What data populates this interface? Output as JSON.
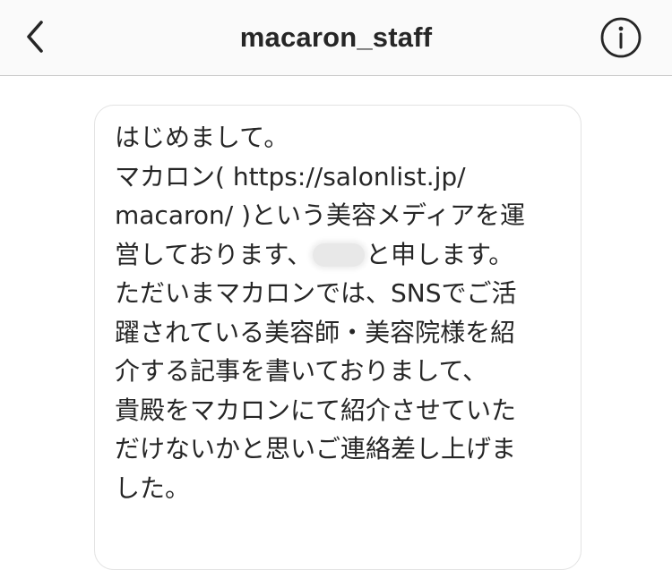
{
  "header": {
    "title": "macaron_staff",
    "back_icon": "chevron-left-icon",
    "info_icon": "info-circle-icon"
  },
  "message": {
    "lines": [
      "はじめまして。",
      "マカロン( https://salonlist.jp/",
      "macaron/ )という美容メディアを運",
      "営しております、",
      "と申します。",
      "ただいまマカロンでは、SNSでご活",
      "躍されている美容師・美容院様を紹",
      "介する記事を書いておりまして、",
      "貴殿をマカロンにて紹介させていた",
      "だけないかと思いご連絡差し上げま",
      "した。"
    ]
  },
  "colors": {
    "header_bg": "#fafafa",
    "text": "#262626",
    "bubble_border": "#e3e3e3"
  }
}
